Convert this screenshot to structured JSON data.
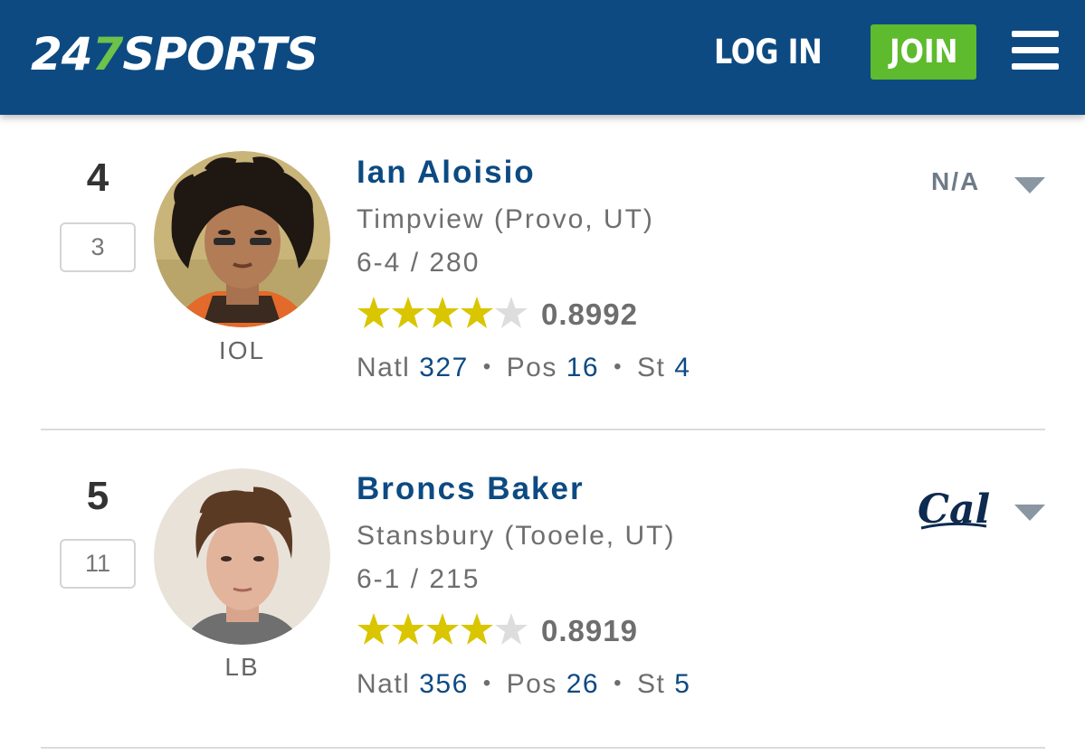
{
  "header": {
    "logo_prefix": "24",
    "logo_seven": "7",
    "logo_suffix": "SPORTS",
    "login_label": "LOG IN",
    "join_label": "JOIN",
    "bg_color": "#0d4a82",
    "join_color": "#5dbb2d"
  },
  "players": [
    {
      "rank": "4",
      "position_rank": "3",
      "name": "Ian Aloisio",
      "school": "Timpview (Provo, UT)",
      "height_weight": "6-4 / 280",
      "position": "IOL",
      "stars": 4,
      "rating": "0.8992",
      "natl_label": "Natl",
      "natl": "327",
      "pos_label": "Pos",
      "pos": "16",
      "st_label": "St",
      "st": "4",
      "commit": "N/A"
    },
    {
      "rank": "5",
      "position_rank": "11",
      "name": "Broncs Baker",
      "school": "Stansbury (Tooele, UT)",
      "height_weight": "6-1 / 215",
      "position": "LB",
      "stars": 4,
      "rating": "0.8919",
      "natl_label": "Natl",
      "natl": "356",
      "pos_label": "Pos",
      "pos": "26",
      "st_label": "St",
      "st": "5",
      "commit_logo": "Cal"
    }
  ],
  "colors": {
    "star_filled": "#d9c500",
    "star_empty": "#dddddd",
    "link": "#0d4a82",
    "text_muted": "#6e6e6e"
  }
}
